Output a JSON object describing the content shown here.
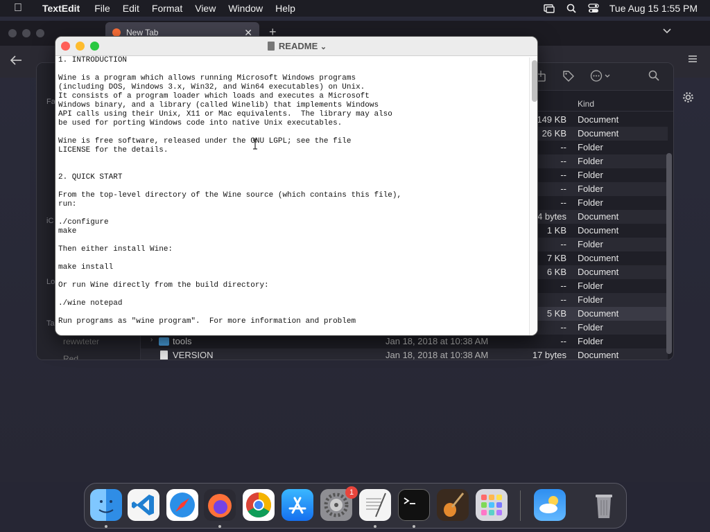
{
  "menubar": {
    "app_name": "TextEdit",
    "items": [
      "File",
      "Edit",
      "Format",
      "View",
      "Window",
      "Help"
    ],
    "datetime": "Tue Aug 15  1:55 PM"
  },
  "firefox": {
    "tab_title": "New Tab",
    "tab_close": "✕",
    "new_tab": "+"
  },
  "finder": {
    "kind_header": "Kind",
    "sidebar_labels": [
      "Fa",
      "iC",
      "Lo",
      "Ta"
    ],
    "sidebar_bottom": [
      "rewwteter",
      "Red"
    ],
    "rows": [
      {
        "name": "",
        "date": "",
        "size": "149 KB",
        "kind": "Document",
        "type": "doc"
      },
      {
        "name": "",
        "date": "",
        "size": "26 KB",
        "kind": "Document",
        "type": "doc"
      },
      {
        "name": "",
        "date": "",
        "size": "--",
        "kind": "Folder",
        "type": "folder"
      },
      {
        "name": "",
        "date": "",
        "size": "--",
        "kind": "Folder",
        "type": "folder"
      },
      {
        "name": "",
        "date": "",
        "size": "--",
        "kind": "Folder",
        "type": "folder"
      },
      {
        "name": "",
        "date": "",
        "size": "--",
        "kind": "Folder",
        "type": "folder"
      },
      {
        "name": "",
        "date": "",
        "size": "--",
        "kind": "Folder",
        "type": "folder"
      },
      {
        "name": "",
        "date": "",
        "size": "4 bytes",
        "kind": "Document",
        "type": "doc"
      },
      {
        "name": "",
        "date": "",
        "size": "1 KB",
        "kind": "Document",
        "type": "doc"
      },
      {
        "name": "",
        "date": "",
        "size": "--",
        "kind": "Folder",
        "type": "folder"
      },
      {
        "name": "",
        "date": "",
        "size": "7 KB",
        "kind": "Document",
        "type": "doc"
      },
      {
        "name": "",
        "date": "",
        "size": "6 KB",
        "kind": "Document",
        "type": "doc"
      },
      {
        "name": "",
        "date": "",
        "size": "--",
        "kind": "Folder",
        "type": "folder"
      },
      {
        "name": "",
        "date": "",
        "size": "--",
        "kind": "Folder",
        "type": "folder"
      },
      {
        "name": "",
        "date": "",
        "size": "5 KB",
        "kind": "Document",
        "type": "doc",
        "selected": true
      },
      {
        "name": "",
        "date": "",
        "size": "--",
        "kind": "Folder",
        "type": "folder"
      },
      {
        "name": "tools",
        "date": "Jan 18, 2018 at 10:38 AM",
        "size": "--",
        "kind": "Folder",
        "type": "folder",
        "disclosure": "›"
      },
      {
        "name": "VERSION",
        "date": "Jan 18, 2018 at 10:38 AM",
        "size": "17 bytes",
        "kind": "Document",
        "type": "doc"
      }
    ]
  },
  "textedit": {
    "title": "README",
    "title_chevron": "⌄",
    "lines": [
      "1. INTRODUCTION",
      "",
      "Wine is a program which allows running Microsoft Windows programs",
      "(including DOS, Windows 3.x, Win32, and Win64 executables) on Unix.",
      "It consists of a program loader which loads and executes a Microsoft",
      "Windows binary, and a library (called Winelib) that implements Windows",
      "API calls using their Unix, X11 or Mac equivalents.  The library may also",
      "be used for porting Windows code into native Unix executables.",
      "",
      "Wine is free software, released under the GNU LGPL; see the file",
      "LICENSE for the details.",
      "",
      "",
      "2. QUICK START",
      "",
      "From the top-level directory of the Wine source (which contains this file),",
      "run:",
      "",
      "./configure",
      "make",
      "",
      "Then either install Wine:",
      "",
      "make install",
      "",
      "Or run Wine directly from the build directory:",
      "",
      "./wine notepad",
      "",
      "Run programs as \"wine program\".  For more information and problem"
    ]
  },
  "dock": {
    "apps": [
      "Finder",
      "Visual Studio Code",
      "Safari",
      "Firefox",
      "Google Chrome",
      "App Store",
      "System Settings",
      "TextEdit",
      "Terminal",
      "GarageBand",
      "Launchpad",
      "Weather",
      "Trash"
    ],
    "settings_badge": "1"
  },
  "colors": {
    "close": "#ff5f57",
    "minimize": "#febc2e",
    "zoom": "#28c840"
  }
}
